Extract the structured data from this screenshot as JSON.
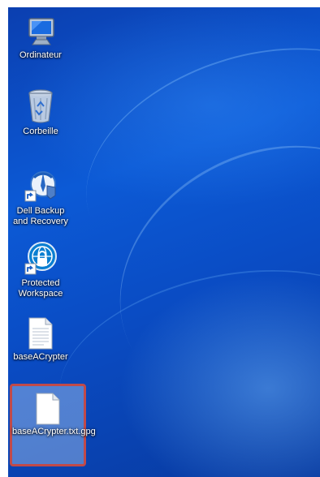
{
  "desktop": {
    "icons": [
      {
        "label": "Ordinateur",
        "icon": "computer-icon"
      },
      {
        "label": "Corbeille",
        "icon": "recycle-bin-icon"
      },
      {
        "label": "Dell Backup and Recovery",
        "icon": "dell-backup-icon"
      },
      {
        "label": "Protected Workspace",
        "icon": "protected-workspace-icon"
      },
      {
        "label": "baseACrypter",
        "icon": "text-file-icon"
      },
      {
        "label": "baseACrypter.txt.gpg",
        "icon": "file-icon",
        "selected": true
      }
    ]
  },
  "colors": {
    "wallpaper": "#0c5ad6",
    "selection_border": "#c04a4a",
    "label_text": "#ffffff"
  }
}
